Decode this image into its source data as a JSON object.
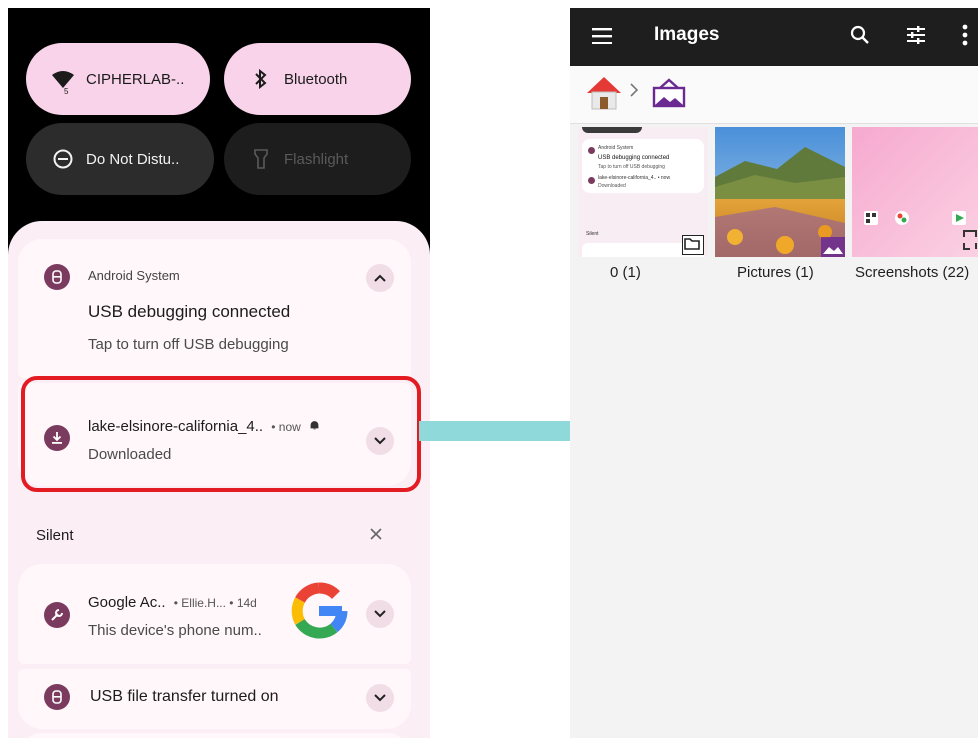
{
  "left": {
    "tiles": [
      {
        "label": "CIPHERLAB-..",
        "icon": "wifi-icon",
        "state": "on"
      },
      {
        "label": "Bluetooth",
        "icon": "bluetooth-icon",
        "state": "on"
      },
      {
        "label": "Do Not Distu..",
        "icon": "do-not-disturb-icon",
        "state": "off"
      },
      {
        "label": "Flashlight",
        "icon": "flashlight-icon",
        "state": "unavailable"
      }
    ],
    "wifi_badge": "5",
    "notifications": {
      "usb_debug": {
        "app": "Android System",
        "title": "USB debugging connected",
        "body": "Tap to turn off USB debugging"
      },
      "download": {
        "title": "lake-elsinore-california_4..",
        "meta": "• now",
        "body": "Downloaded"
      },
      "silent_header": "Silent",
      "google": {
        "title": "Google Ac..",
        "meta": "• Ellie.H... • 14d",
        "body": "This device's phone num..",
        "logo_letter": "G"
      },
      "usb_transfer": {
        "title": "USB file transfer turned on"
      }
    }
  },
  "right": {
    "app_title": "Images",
    "breadcrumb": [
      "home-icon",
      "images-folder-icon"
    ],
    "folders": [
      {
        "caption": "0 (1)"
      },
      {
        "caption": "Pictures (1)"
      },
      {
        "caption": "Screenshots (22)"
      }
    ],
    "mini_notif": {
      "app": "Android System",
      "title": "USB debugging connected",
      "body": "Tap to turn off USB debugging",
      "download": "lake-elsinore-california_4.. • now",
      "download_body": "Downloaded",
      "silent": "Silent"
    }
  },
  "colors": {
    "highlight_border": "#e31b23",
    "arrow": "#8fd9db",
    "tile_on": "#f8d3ea",
    "app_icon": "#7a3b5e"
  }
}
